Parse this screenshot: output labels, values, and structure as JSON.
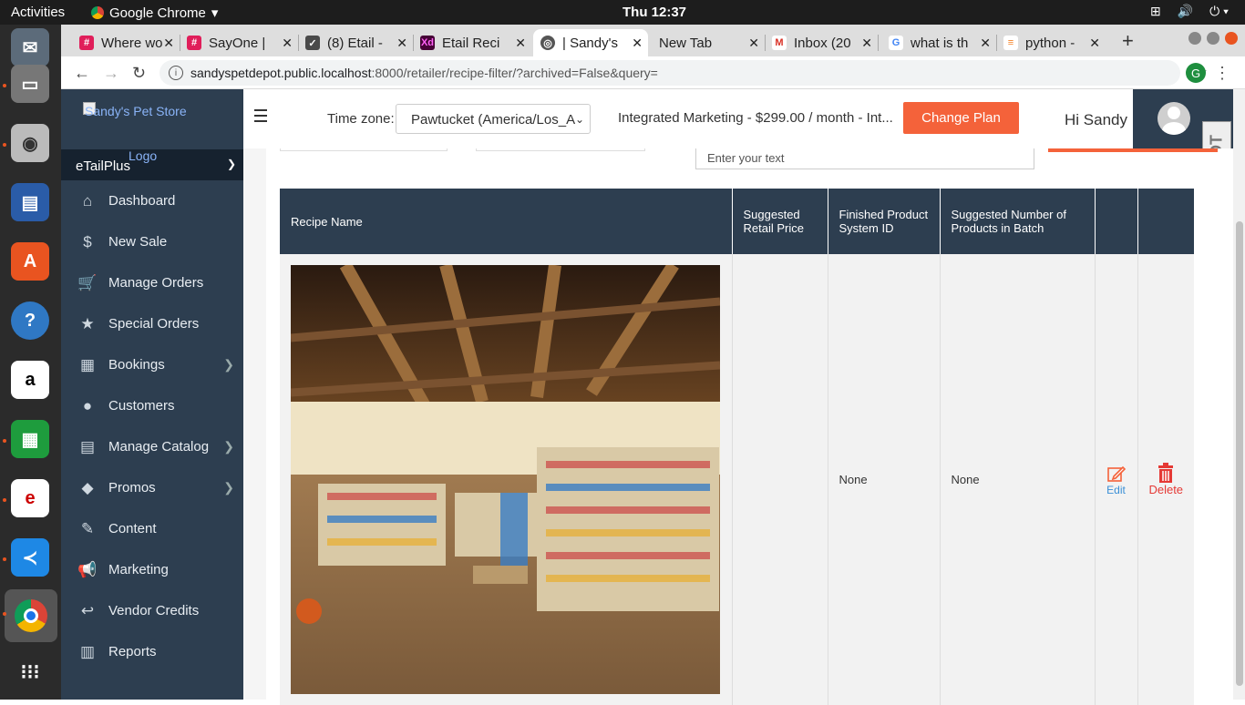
{
  "os": {
    "activities": "Activities",
    "app_name": "Google Chrome",
    "clock": "Thu 12:37"
  },
  "tabs": [
    {
      "title": "Where wo",
      "icon_color": "#e01e5a",
      "icon": "slack-icon"
    },
    {
      "title": "SayOne |",
      "icon_color": "#e01e5a",
      "icon": "slack-icon"
    },
    {
      "title": "(8) Etail -",
      "icon_color": "#4a4a4a",
      "icon": "check-icon"
    },
    {
      "title": "Etail Reci",
      "icon_color": "#470137",
      "icon": "xd-icon",
      "icon_text": "Xd"
    },
    {
      "title": "| Sandy's",
      "icon_color": "#555",
      "icon": "globe-icon",
      "active": true
    },
    {
      "title": "New Tab",
      "icon": "none"
    },
    {
      "title": "Inbox (20",
      "icon_color": "#d93025",
      "icon": "gmail-icon",
      "icon_text": "M"
    },
    {
      "title": "what is th",
      "icon_color": "#4285f4",
      "icon": "google-icon",
      "icon_text": "G"
    },
    {
      "title": "python - ",
      "icon_color": "#f48024",
      "icon": "stackoverflow-icon"
    }
  ],
  "address": {
    "host": "sandyspetdepot.public.localhost",
    "rest": ":8000/retailer/recipe-filter/?archived=False&query=",
    "profile": "G"
  },
  "sidebar": {
    "logo_alt": "Sandy's Pet Store",
    "brand": "eTailPlus",
    "logo_word": "Logo",
    "items": [
      {
        "label": "Dashboard",
        "icon": "home-icon",
        "glyph": "⌂"
      },
      {
        "label": "New Sale",
        "icon": "dollar-icon",
        "glyph": "$"
      },
      {
        "label": "Manage Orders",
        "icon": "cart-icon",
        "glyph": "🛒"
      },
      {
        "label": "Special Orders",
        "icon": "star-icon",
        "glyph": "★"
      },
      {
        "label": "Bookings",
        "icon": "calendar-icon",
        "glyph": "▦",
        "arrow": true
      },
      {
        "label": "Customers",
        "icon": "user-icon",
        "glyph": "●"
      },
      {
        "label": "Manage Catalog",
        "icon": "catalog-icon",
        "glyph": "▤",
        "arrow": true
      },
      {
        "label": "Promos",
        "icon": "tag-icon",
        "glyph": "◆",
        "arrow": true
      },
      {
        "label": "Content",
        "icon": "edit-icon",
        "glyph": "✎"
      },
      {
        "label": "Marketing",
        "icon": "megaphone-icon",
        "glyph": "📢"
      },
      {
        "label": "Vendor Credits",
        "icon": "reply-icon",
        "glyph": "↩"
      },
      {
        "label": "Reports",
        "icon": "file-icon",
        "glyph": "▥"
      }
    ]
  },
  "header": {
    "timezone_label": "Time zone:",
    "timezone_value": "Pawtucket (America/Los_A",
    "plan": "Integrated Marketing - $299.00 / month - Int...",
    "change_plan": "Change Plan",
    "greeting": "Hi Sandy"
  },
  "search": {
    "placeholder": "Enter your text"
  },
  "table": {
    "headers": [
      "Recipe Name",
      "Suggested Retail Price",
      "Finished Product System ID",
      "Suggested Number of Products in Batch",
      "",
      ""
    ],
    "rows": [
      {
        "system_id": "None",
        "batch": "None",
        "edit": "Edit",
        "delete": "Delete"
      }
    ]
  },
  "colors": {
    "sidebar": "#2d3e50",
    "accent": "#f4623a",
    "edit": "#3a8fd6",
    "delete": "#e53935"
  }
}
